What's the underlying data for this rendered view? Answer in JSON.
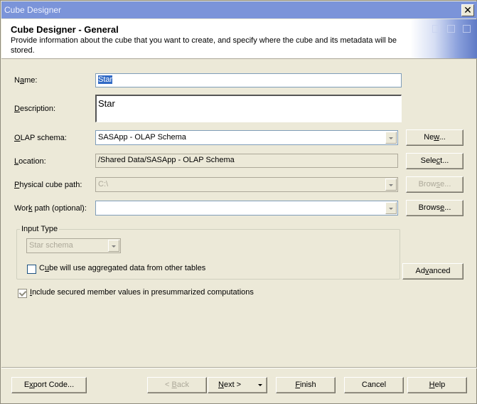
{
  "window": {
    "title": "Cube Designer",
    "close_icon": "close-icon"
  },
  "header": {
    "title": "Cube Designer - General",
    "description": "Provide information about the cube that you want to create, and specify where the cube and its metadata will be stored."
  },
  "form": {
    "name": {
      "label_pre": "N",
      "label_u": "a",
      "label_post": "me:",
      "value": "Star"
    },
    "description": {
      "label_pre": "",
      "label_u": "D",
      "label_post": "escription:",
      "value": "Star"
    },
    "olap_schema": {
      "label_pre": "",
      "label_u": "O",
      "label_post": "LAP schema:",
      "value": "SASApp - OLAP Schema",
      "button_pre": "Ne",
      "button_u": "w",
      "button_post": "..."
    },
    "location": {
      "label_pre": "",
      "label_u": "L",
      "label_post": "ocation:",
      "value": "/Shared Data/SASApp - OLAP Schema",
      "button_pre": "Sele",
      "button_u": "c",
      "button_post": "t..."
    },
    "physical_cube_path": {
      "label_pre": "",
      "label_u": "P",
      "label_post": "hysical cube path:",
      "value": "C:\\",
      "button_pre": "Brow",
      "button_u": "s",
      "button_post": "e...",
      "disabled": true
    },
    "work_path": {
      "label_pre": "Wor",
      "label_u": "k",
      "label_post": " path (optional):",
      "value": "",
      "button_pre": "Brows",
      "button_u": "e",
      "button_post": "..."
    }
  },
  "input_type": {
    "legend": "Input Type",
    "select_value": "Star schema",
    "aggregated_checkbox": {
      "label_pre": "C",
      "label_u": "u",
      "label_post": "be will use aggregated data from other tables",
      "checked": false
    },
    "advanced_pre": "Ad",
    "advanced_u": "v",
    "advanced_post": "anced"
  },
  "secured_checkbox": {
    "label_pre": "",
    "label_u": "I",
    "label_post": "nclude secured member values in presummarized computations",
    "checked": true
  },
  "footer": {
    "export_pre": "E",
    "export_u": "x",
    "export_post": "port Code...",
    "back_pre": "< ",
    "back_u": "B",
    "back_post": "ack",
    "next_pre": "",
    "next_u": "N",
    "next_post": "ext >",
    "finish_pre": "",
    "finish_u": "F",
    "finish_post": "inish",
    "cancel": "Cancel",
    "help_pre": "",
    "help_u": "H",
    "help_post": "elp"
  }
}
